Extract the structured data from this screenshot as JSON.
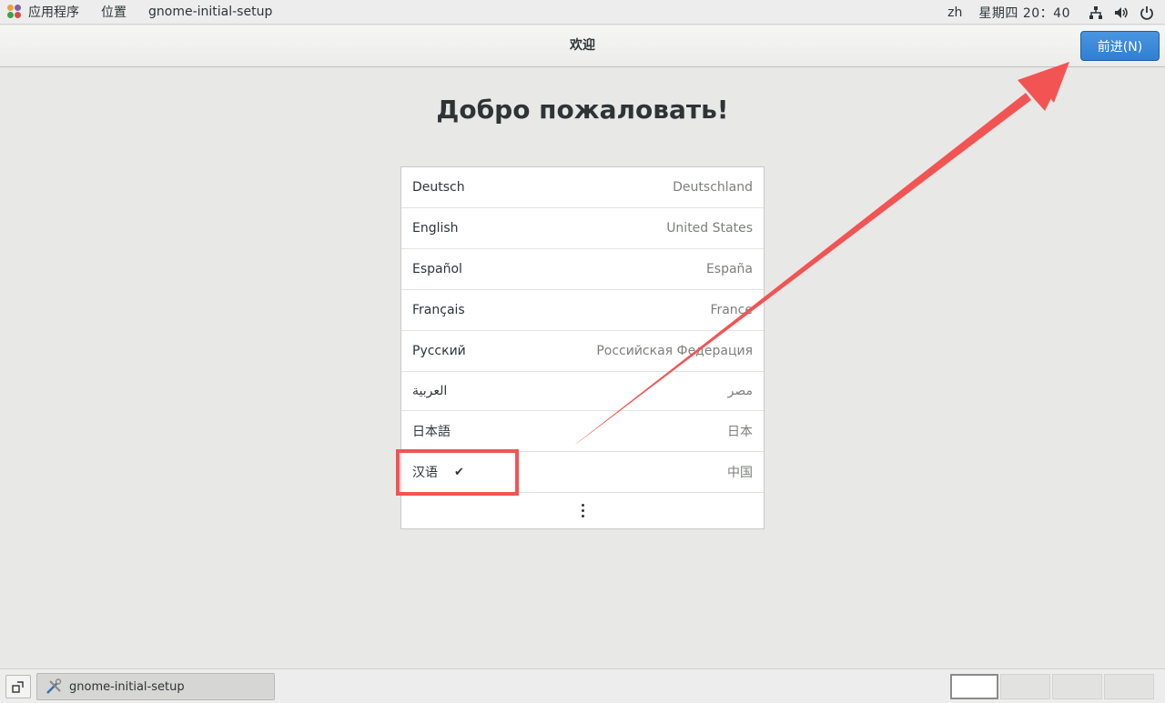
{
  "top_panel": {
    "apps_label": "应用程序",
    "places_label": "位置",
    "app_label": "gnome-initial-setup",
    "input_lang": "zh",
    "clock": "星期四 20：40",
    "icons": [
      "network-icon",
      "volume-icon",
      "power-icon"
    ]
  },
  "header": {
    "title": "欢迎",
    "next_label": "前进(N)",
    "accent_color": "#3584e4"
  },
  "main": {
    "welcome_title": "Добро пожаловать!",
    "languages": [
      {
        "name": "Deutsch",
        "region": "Deutschland",
        "selected": false
      },
      {
        "name": "English",
        "region": "United States",
        "selected": false
      },
      {
        "name": "Español",
        "region": "España",
        "selected": false
      },
      {
        "name": "Français",
        "region": "France",
        "selected": false
      },
      {
        "name": "Русский",
        "region": "Российская Федерация",
        "selected": false
      },
      {
        "name": "العربية",
        "region": "مصر",
        "selected": false
      },
      {
        "name": "日本語",
        "region": "日本",
        "selected": false
      },
      {
        "name": "汉语",
        "region": "中国",
        "selected": true
      }
    ],
    "selected_check": "✔",
    "more_icon": "view-more-icon"
  },
  "annotation": {
    "color": "#f25454"
  },
  "bottom_panel": {
    "task_label": "gnome-initial-setup",
    "workspace_count": 4,
    "active_workspace": 1
  }
}
